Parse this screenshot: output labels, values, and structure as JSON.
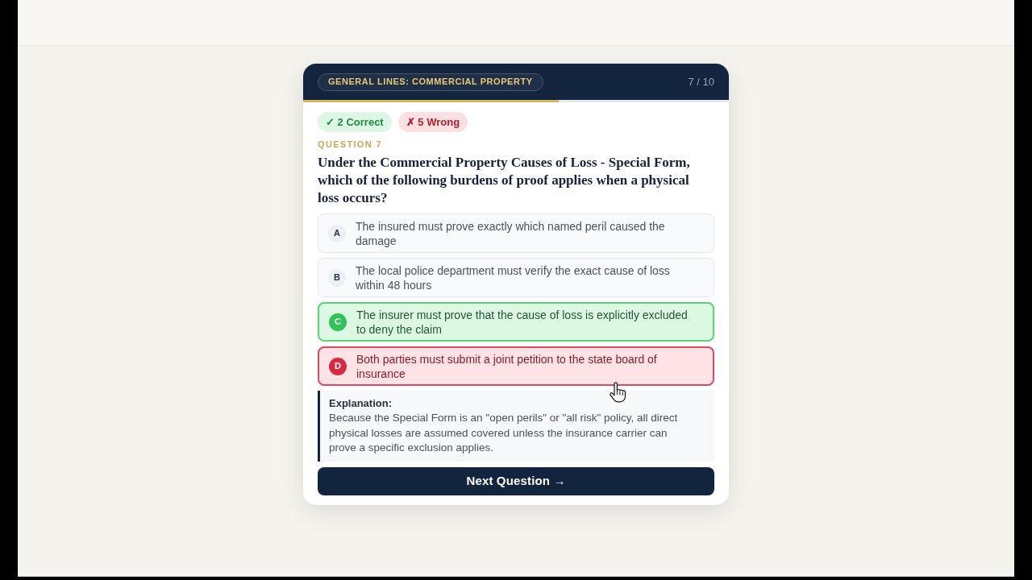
{
  "header": {
    "category": "GENERAL LINES: COMMERCIAL PROPERTY",
    "counter": "7 / 10"
  },
  "progress": {
    "level": 0.6
  },
  "score_badges": [
    {
      "kind": "correct",
      "text": "✓ 2 Correct"
    },
    {
      "kind": "wrong",
      "text": "✗ 5 Wrong"
    }
  ],
  "question": {
    "label": "QUESTION 7",
    "text": "Under the Commercial Property Causes of Loss - Special Form, which of the following burdens of proof applies when a physical loss occurs?"
  },
  "options": [
    {
      "letter": "A",
      "text": "The insured must prove exactly which named peril caused the damage",
      "selected": false,
      "correct": false
    },
    {
      "letter": "B",
      "text": "The local police department must verify the exact cause of loss within 48 hours",
      "selected": false,
      "correct": false
    },
    {
      "letter": "C",
      "text": "The insurer must prove that the cause of loss is explicitly excluded to deny the claim",
      "selected": false,
      "correct": true
    },
    {
      "letter": "D",
      "text": "Both parties must submit a joint petition to the state board of insurance",
      "selected": true,
      "correct": false
    }
  ],
  "explanation": {
    "title": "Explanation:",
    "text": "Because the Special Form is an \"open perils\" or \"all risk\" policy, all direct physical losses are assumed covered unless the insurance carrier can prove a specific exclusion applies."
  },
  "next_button": {
    "label": "Next Question →"
  }
}
